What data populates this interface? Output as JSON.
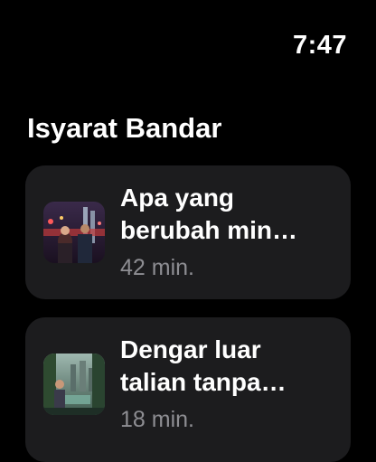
{
  "status": {
    "time": "7:47"
  },
  "section": {
    "title": "Isyarat Bandar"
  },
  "episodes": [
    {
      "title_line1": "Apa yang",
      "title_line2": "berubah min…",
      "duration": "42 min."
    },
    {
      "title_line1": "Dengar luar",
      "title_line2": "talian tanpa…",
      "duration": "18 min."
    }
  ]
}
